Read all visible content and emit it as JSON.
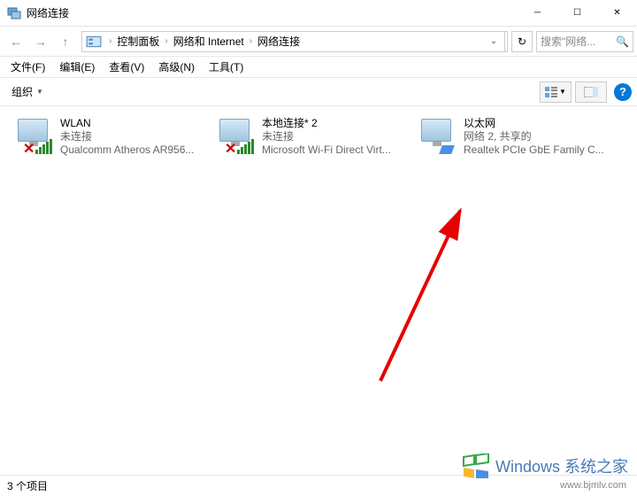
{
  "window": {
    "title": "网络连接"
  },
  "breadcrumb": {
    "root": "控制面板",
    "mid": "网络和 Internet",
    "leaf": "网络连接"
  },
  "search": {
    "placeholder": "搜索\"网络..."
  },
  "menubar": [
    {
      "label": "文件(F)"
    },
    {
      "label": "编辑(E)"
    },
    {
      "label": "查看(V)"
    },
    {
      "label": "高级(N)"
    },
    {
      "label": "工具(T)"
    }
  ],
  "toolbar": {
    "organize": "组织"
  },
  "connections": [
    {
      "name": "WLAN",
      "status": "未连接",
      "adapter": "Qualcomm Atheros AR956...",
      "disconnected": true,
      "type": "wifi"
    },
    {
      "name": "本地连接* 2",
      "status": "未连接",
      "adapter": "Microsoft Wi-Fi Direct Virt...",
      "disconnected": true,
      "type": "wifi"
    },
    {
      "name": "以太网",
      "status": "网络 2, 共享的",
      "adapter": "Realtek PCIe GbE Family C...",
      "disconnected": false,
      "type": "eth"
    }
  ],
  "statusbar": {
    "count": "3 个项目"
  },
  "watermark": {
    "text": "Windows 系统之家",
    "url": "www.bjmlv.com"
  }
}
